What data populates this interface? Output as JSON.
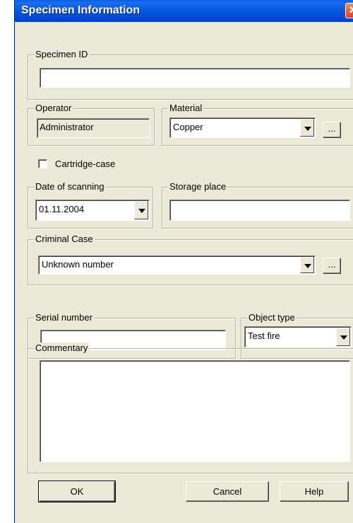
{
  "window": {
    "title": "Specimen Information",
    "close_glyph": "✕"
  },
  "specimen": {
    "group_label": "Specimen ID",
    "value": ""
  },
  "operator": {
    "group_label": "Operator",
    "value": "Administrator"
  },
  "material": {
    "group_label": "Material",
    "selected": "Copper",
    "browse_label": "..."
  },
  "cartridge": {
    "label": "Cartridge-case",
    "checked": false
  },
  "date": {
    "group_label": "Date of scanning",
    "selected": "01.11.2004"
  },
  "storage": {
    "group_label": "Storage place",
    "value": ""
  },
  "criminal_case": {
    "group_label": "Criminal Case",
    "selected": "Unknown number",
    "browse_label": "..."
  },
  "serial": {
    "group_label": "Serial number",
    "value": ""
  },
  "object_type": {
    "group_label": "Object type",
    "selected": "Test fire"
  },
  "commentary": {
    "group_label": "Commentary",
    "value": ""
  },
  "buttons": {
    "ok": "OK",
    "cancel": "Cancel",
    "help": "Help"
  },
  "icons": {
    "dropdown": "chevron-down-icon",
    "close": "close-icon"
  },
  "colors": {
    "titlebar": "#0553d8",
    "face": "#ece9d8",
    "close": "#d5452a"
  }
}
